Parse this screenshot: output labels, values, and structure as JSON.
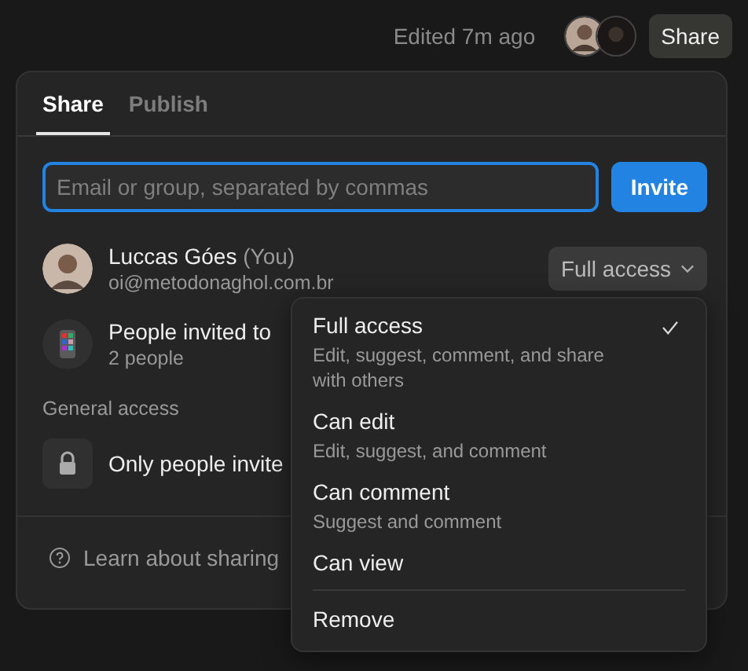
{
  "top_bar": {
    "edited": "Edited 7m ago",
    "share_button": "Share"
  },
  "share_panel": {
    "tabs": [
      {
        "label": "Share",
        "selected": true
      },
      {
        "label": "Publish",
        "selected": false
      }
    ],
    "invite_field": {
      "placeholder": "Email or group, separated by commas"
    },
    "invite_button": "Invite",
    "owner": {
      "name": "Luccas Góes",
      "suffix": "(You)",
      "email": "oi@metodonaghol.com.br",
      "access": "Full access"
    },
    "group": {
      "name": "People invited to",
      "count": "2 people"
    },
    "general_access_label": "General access",
    "general_access": "Only people invite",
    "learn_link": "Learn about sharing"
  },
  "access_menu": {
    "options": [
      {
        "title": "Full access",
        "description": "Edit, suggest, comment, and share with others",
        "selected": true
      },
      {
        "title": "Can edit",
        "description": "Edit, suggest, and comment",
        "selected": false
      },
      {
        "title": "Can comment",
        "description": "Suggest and comment",
        "selected": false
      },
      {
        "title": "Can view",
        "selected": false
      }
    ],
    "remove": "Remove"
  }
}
